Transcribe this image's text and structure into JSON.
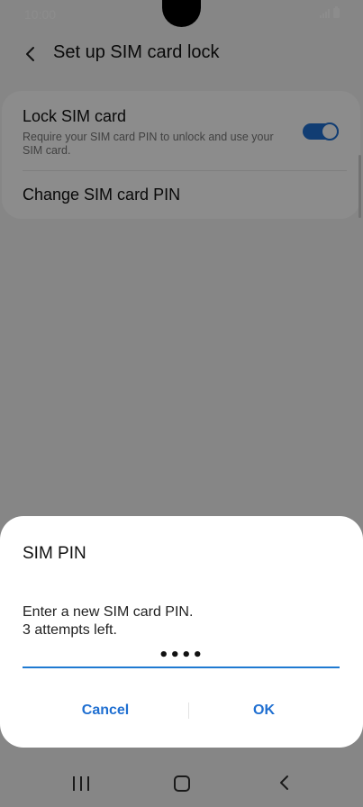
{
  "status_bar": {
    "time": "10:00"
  },
  "header": {
    "title": "Set up SIM card lock"
  },
  "settings": {
    "lock_sim": {
      "title": "Lock SIM card",
      "description": "Require your SIM card PIN to unlock and use your SIM card.",
      "enabled": true
    },
    "change_pin": {
      "title": "Change SIM card PIN"
    }
  },
  "dialog": {
    "title": "SIM PIN",
    "message": "Enter a new SIM card PIN.\n3 attempts left.",
    "pin_value": "••••",
    "cancel_label": "Cancel",
    "ok_label": "OK"
  },
  "colors": {
    "accent": "#1f6fd1",
    "background": "#f4f4f4",
    "card": "#ffffff"
  }
}
